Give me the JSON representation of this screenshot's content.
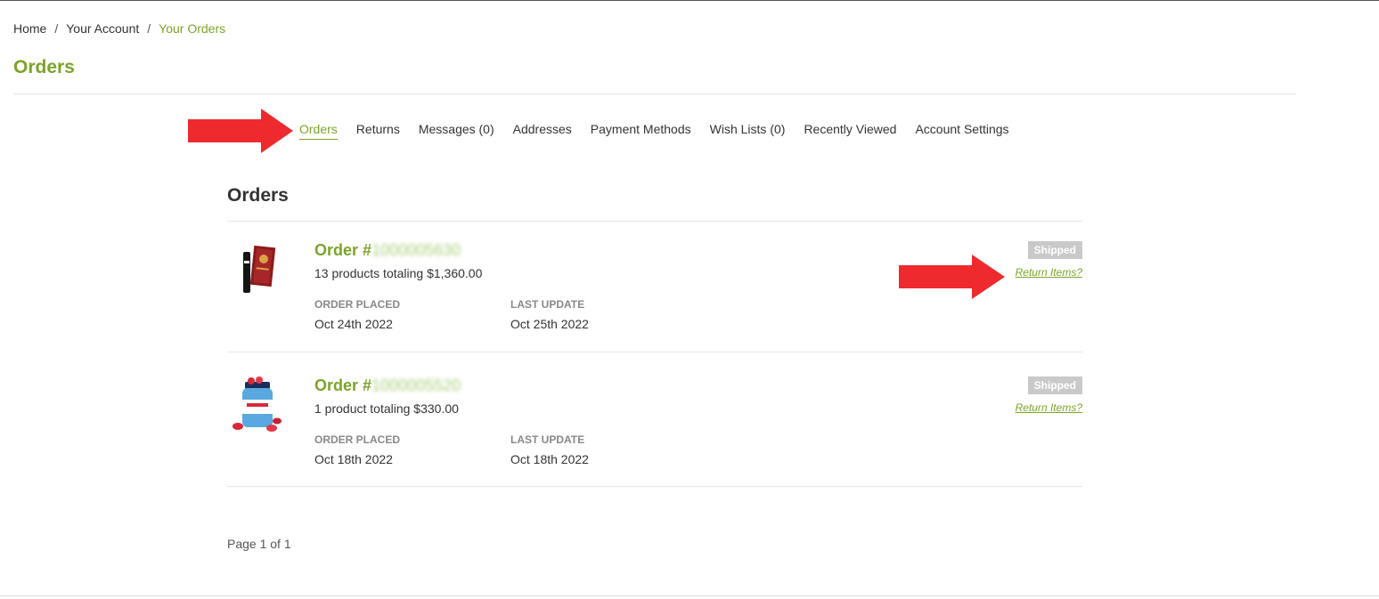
{
  "breadcrumb": {
    "items": [
      "Home",
      "Your Account",
      "Your Orders"
    ],
    "separator": "/"
  },
  "page_title": "Orders",
  "account_nav": {
    "items": [
      "Orders",
      "Returns",
      "Messages (0)",
      "Addresses",
      "Payment Methods",
      "Wish Lists (0)",
      "Recently Viewed",
      "Account Settings"
    ],
    "active": "Orders"
  },
  "section_title": "Orders",
  "orders": [
    {
      "title_prefix": "Order #",
      "number": "1000005630",
      "summary": "13 products totaling $1,360.00",
      "placed_label": "ORDER PLACED",
      "placed": "Oct 24th 2022",
      "update_label": "LAST UPDATE",
      "updated": "Oct 25th 2022",
      "status": "Shipped",
      "return_link": "Return Items?",
      "thumbnail_icon": "vape-box-product-icon"
    },
    {
      "title_prefix": "Order #",
      "number": "1000005520",
      "summary": "1 product totaling $330.00",
      "placed_label": "ORDER PLACED",
      "placed": "Oct 18th 2022",
      "update_label": "LAST UPDATE",
      "updated": "Oct 18th 2022",
      "status": "Shipped",
      "return_link": "Return Items?",
      "thumbnail_icon": "gummies-jar-product-icon"
    }
  ],
  "pagination": "Page 1 of 1",
  "colors": {
    "accent": "#7ba428",
    "status_badge": "#c9c9c9",
    "annotation_arrow": "#ee2a2e"
  }
}
